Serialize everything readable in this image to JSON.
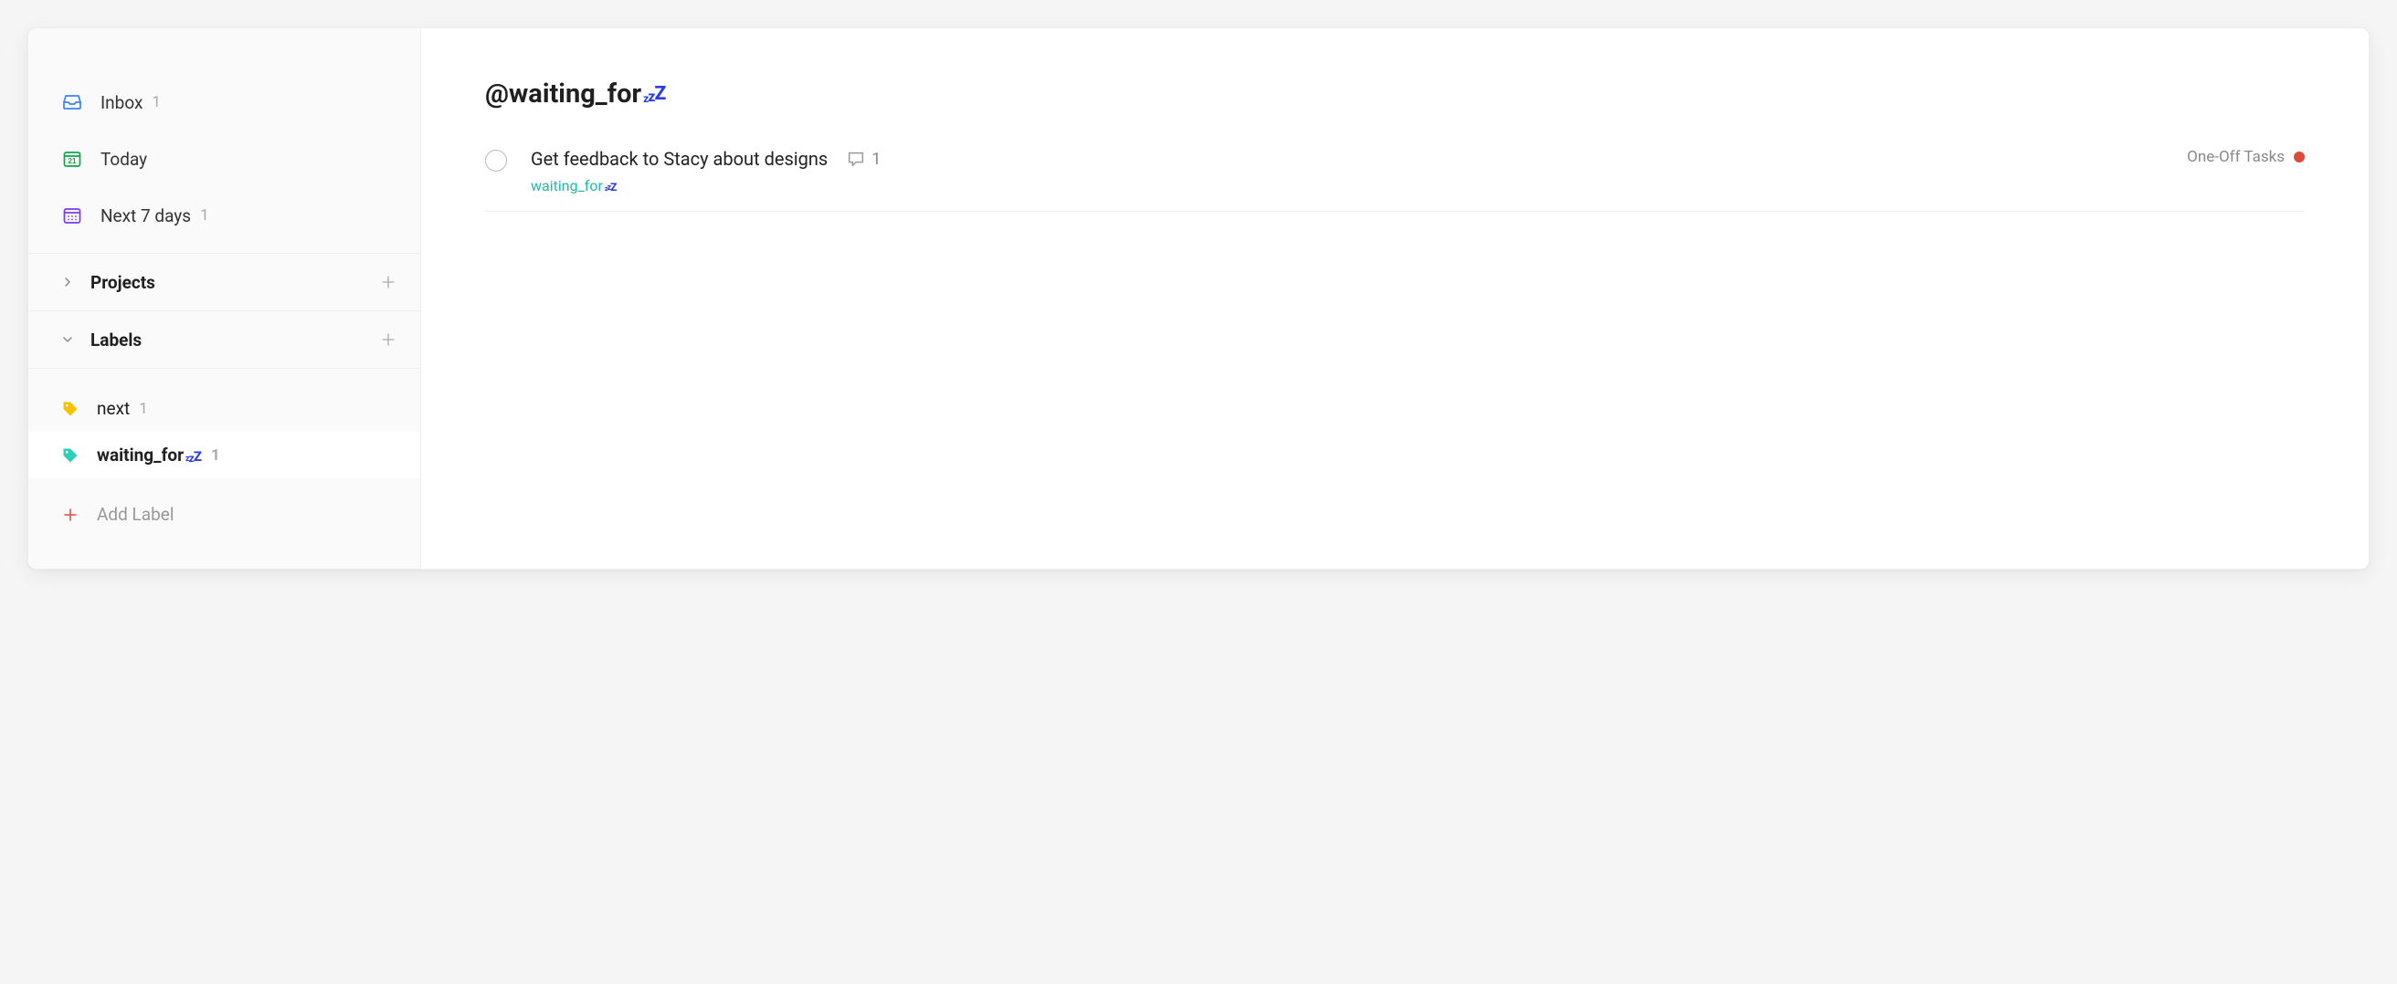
{
  "sidebar": {
    "inbox": {
      "label": "Inbox",
      "count": "1"
    },
    "today": {
      "label": "Today"
    },
    "next7": {
      "label": "Next 7 days",
      "count": "1"
    },
    "sections": {
      "projects": {
        "label": "Projects"
      },
      "labels": {
        "label": "Labels"
      }
    },
    "labels": [
      {
        "name": "next",
        "count": "1",
        "color": "#f8c200"
      },
      {
        "name": "waiting_for",
        "count": "1",
        "color": "#2ecfb7",
        "zzz_color": "#2b3ee6"
      }
    ],
    "add_label": "Add Label"
  },
  "main": {
    "title_prefix": "@",
    "title": "waiting_for",
    "title_zzz_color": "#2b3ee6",
    "tasks": [
      {
        "title": "Get feedback to Stacy about designs",
        "comments": "1",
        "label": "waiting_for",
        "label_zzz_color": "#2b3ee6",
        "project": "One-Off Tasks",
        "project_color": "#dd4b39"
      }
    ]
  }
}
